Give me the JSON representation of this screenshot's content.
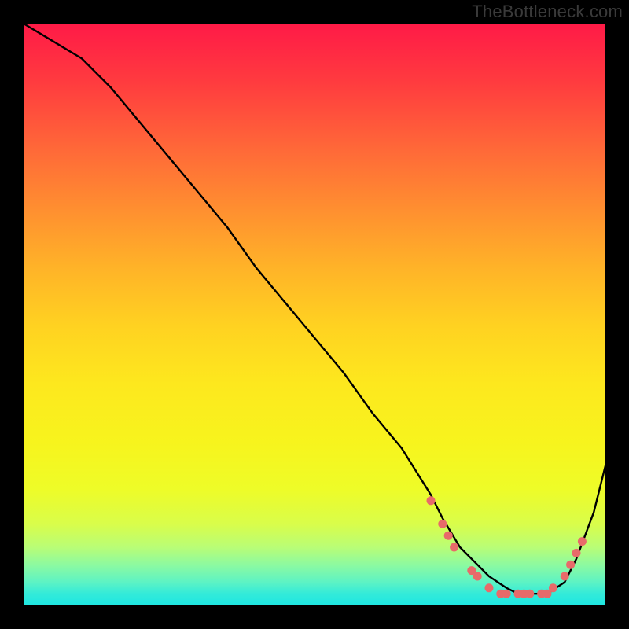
{
  "watermark": "TheBottleneck.com",
  "chart_data": {
    "type": "line",
    "title": "",
    "xlabel": "",
    "ylabel": "",
    "xlim": [
      0,
      100
    ],
    "ylim": [
      0,
      100
    ],
    "series": [
      {
        "name": "curve",
        "x": [
          0,
          5,
          10,
          15,
          20,
          25,
          30,
          35,
          40,
          45,
          50,
          55,
          60,
          65,
          70,
          72,
          75,
          78,
          80,
          83,
          85,
          88,
          90,
          93,
          95,
          98,
          100
        ],
        "y": [
          100,
          97,
          94,
          89,
          83,
          77,
          71,
          65,
          58,
          52,
          46,
          40,
          33,
          27,
          19,
          15,
          10,
          7,
          5,
          3,
          2,
          2,
          2,
          4,
          8,
          16,
          24
        ]
      }
    ],
    "markers": [
      {
        "x": 70,
        "y": 18
      },
      {
        "x": 72,
        "y": 14
      },
      {
        "x": 73,
        "y": 12
      },
      {
        "x": 74,
        "y": 10
      },
      {
        "x": 77,
        "y": 6
      },
      {
        "x": 78,
        "y": 5
      },
      {
        "x": 80,
        "y": 3
      },
      {
        "x": 82,
        "y": 2
      },
      {
        "x": 83,
        "y": 2
      },
      {
        "x": 85,
        "y": 2
      },
      {
        "x": 86,
        "y": 2
      },
      {
        "x": 87,
        "y": 2
      },
      {
        "x": 89,
        "y": 2
      },
      {
        "x": 90,
        "y": 2
      },
      {
        "x": 91,
        "y": 3
      },
      {
        "x": 93,
        "y": 5
      },
      {
        "x": 94,
        "y": 7
      },
      {
        "x": 95,
        "y": 9
      },
      {
        "x": 96,
        "y": 11
      }
    ],
    "gradient_stops": [
      {
        "pos": 0,
        "color": "#ff1a47"
      },
      {
        "pos": 50,
        "color": "#ffd221"
      },
      {
        "pos": 100,
        "color": "#1ee6e2"
      }
    ]
  }
}
